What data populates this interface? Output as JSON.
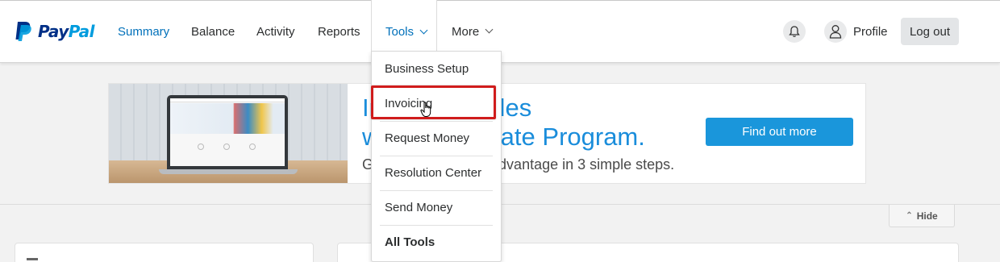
{
  "brand": {
    "pay": "Pay",
    "pal": "Pal",
    "logo_icon": "paypal-p-icon",
    "colors": {
      "pay": "#003087",
      "pal": "#009cde"
    }
  },
  "nav": {
    "links": [
      "Summary",
      "Balance",
      "Activity",
      "Reports",
      "Tools",
      "More"
    ],
    "active": "Summary",
    "open_menu": "Tools",
    "bell_icon": "bell-icon",
    "profile_label": "Profile",
    "logout_label": "Log out"
  },
  "tools_menu": {
    "items": [
      "Business Setup",
      "Invoicing",
      "Request Money",
      "Resolution Center",
      "Send Money",
      "All Tools"
    ],
    "highlighted": "Invoicing",
    "highlight_color": "#d01c1c"
  },
  "banner": {
    "line1": "In             sales",
    "line2": "w             ffiliate Program.",
    "subtitle": "G                          e advantage in 3 simple steps.",
    "cta_label": "Find out more",
    "accent": "#1a96db"
  },
  "hide_label": "Hide"
}
